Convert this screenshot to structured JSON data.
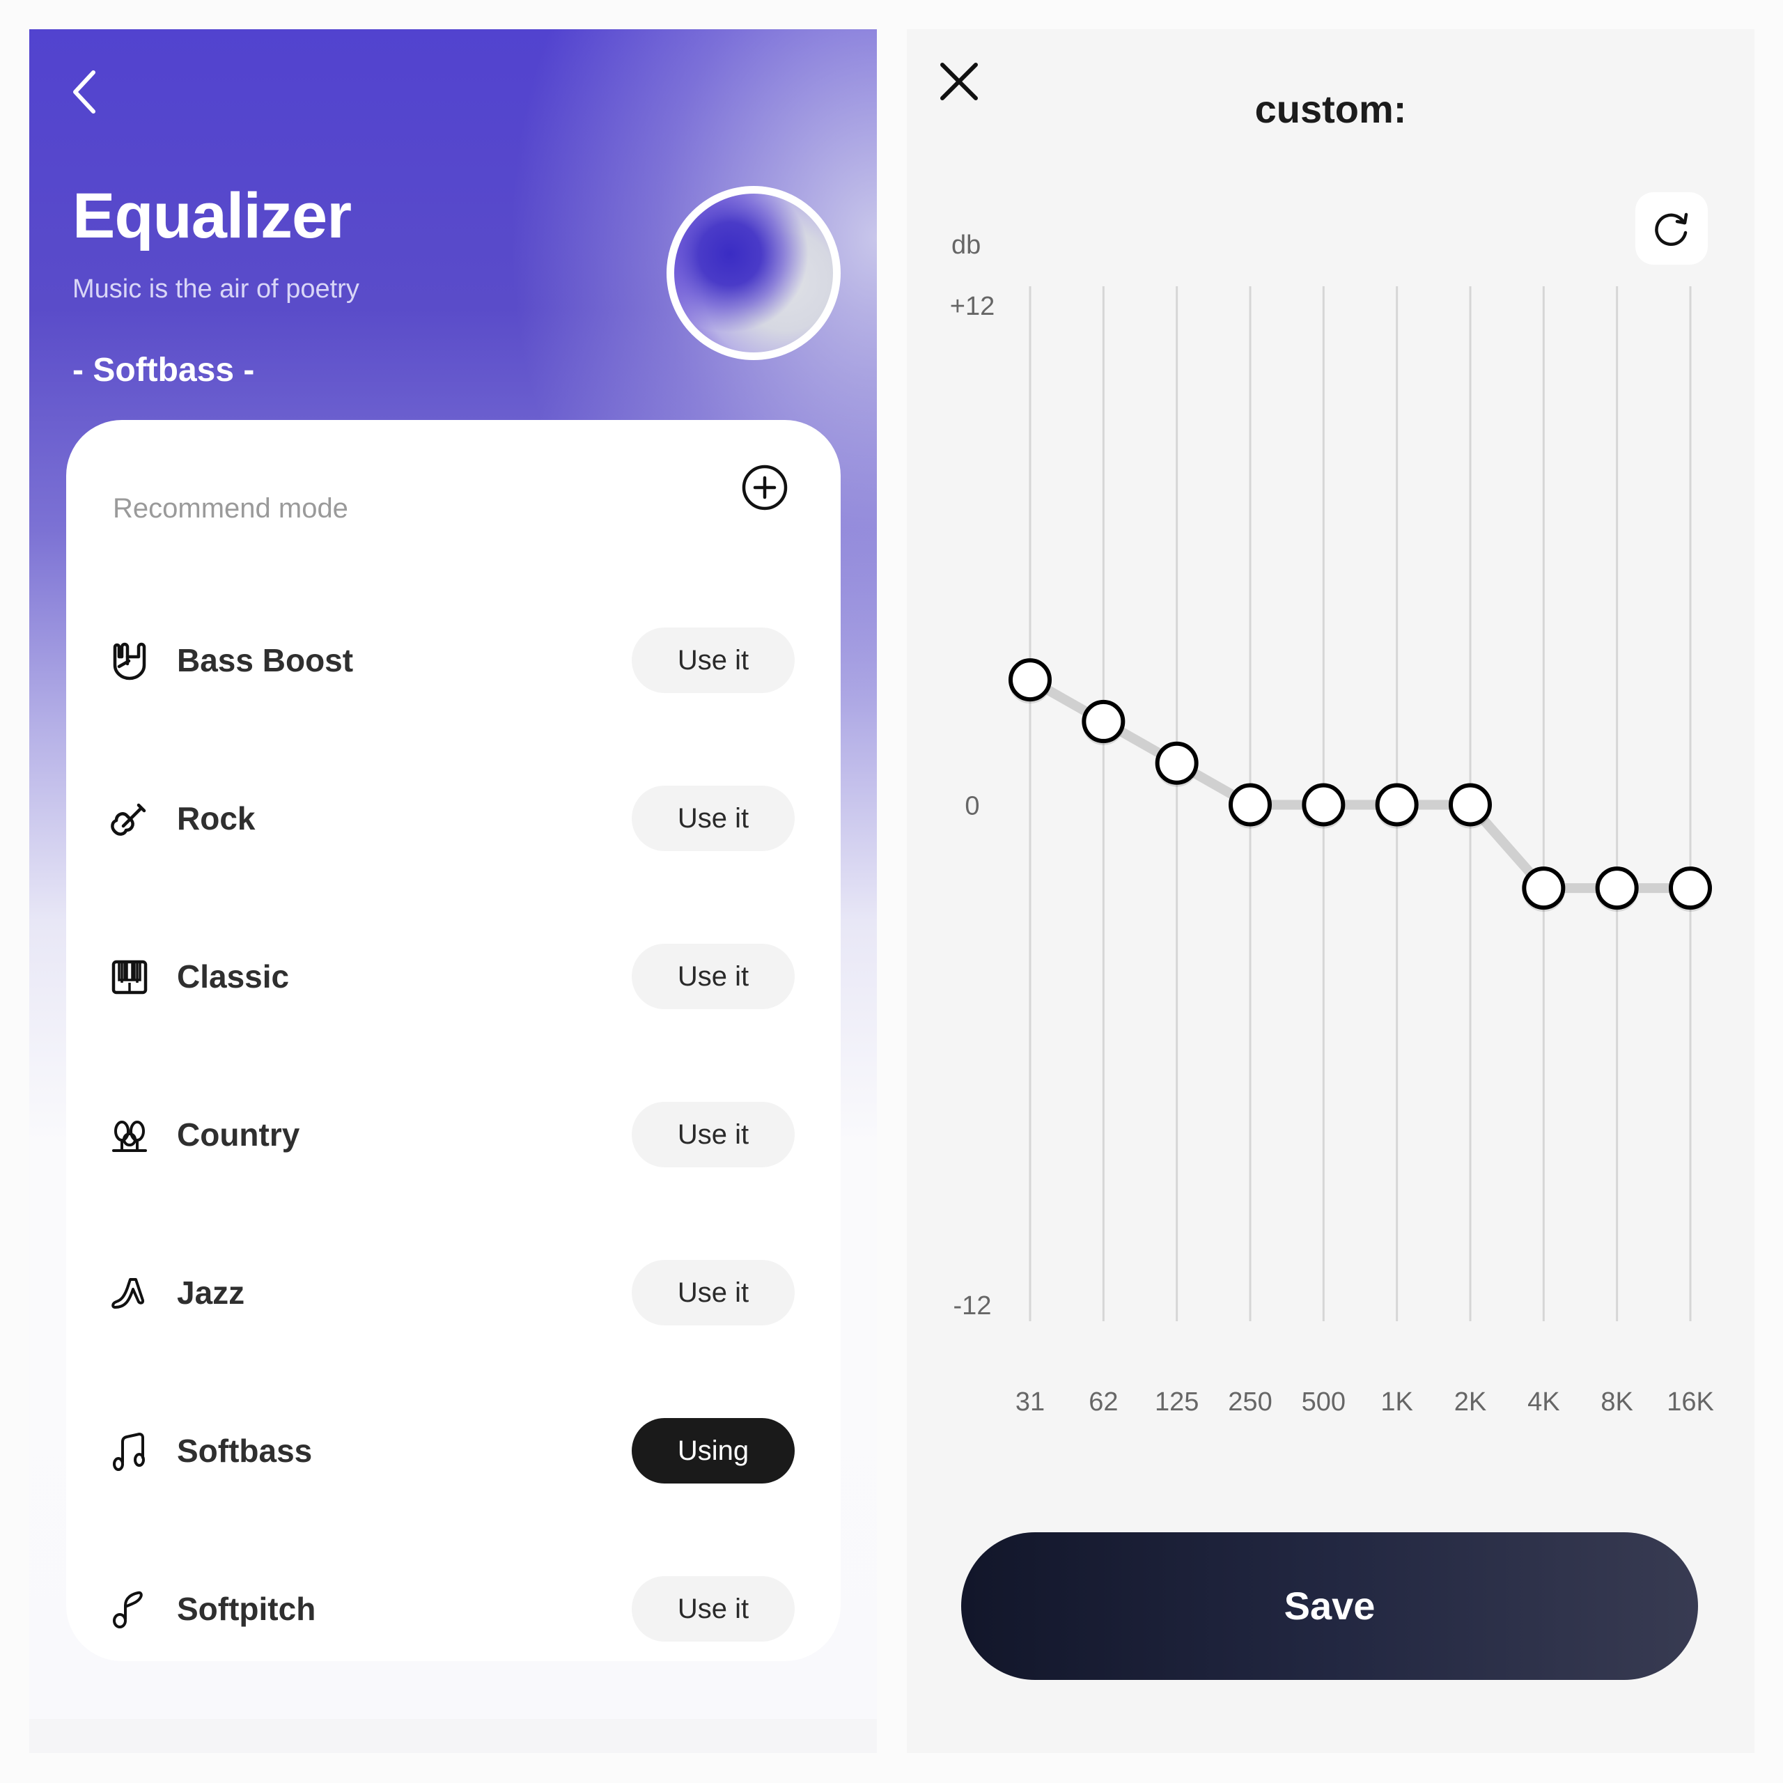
{
  "left": {
    "back_icon": "chevron-left-icon",
    "title": "Equalizer",
    "subtitle": "Music is the air of poetry",
    "current_mode": "- Softbass -",
    "card": {
      "header": "Recommend mode",
      "add_icon": "plus-circle-icon",
      "modes": [
        {
          "name": "Bass Boost",
          "icon": "rock-hand-icon",
          "button": "Use it",
          "active": false
        },
        {
          "name": "Rock",
          "icon": "guitar-icon",
          "button": "Use it",
          "active": false
        },
        {
          "name": "Classic",
          "icon": "piano-icon",
          "button": "Use it",
          "active": false
        },
        {
          "name": "Country",
          "icon": "trees-icon",
          "button": "Use it",
          "active": false
        },
        {
          "name": "Jazz",
          "icon": "saxophone-icon",
          "button": "Use it",
          "active": false
        },
        {
          "name": "Softbass",
          "icon": "music-notes-icon",
          "button": "Using",
          "active": true
        },
        {
          "name": "Softpitch",
          "icon": "music-note-icon",
          "button": "Use it",
          "active": false
        }
      ]
    },
    "colors": {
      "header_top": "#5243cf",
      "active_button": "#1a1a1a",
      "inactive_button": "#f3f3f3"
    }
  },
  "right": {
    "close_icon": "close-icon",
    "title": "custom:",
    "reset_icon": "refresh-icon",
    "save_label": "Save",
    "colors": {
      "save_button_start": "#12162a",
      "save_button_end": "#383b52",
      "line": "#cfcfcf",
      "point_stroke": "#000000"
    }
  },
  "chart_data": {
    "type": "line",
    "title": "custom:",
    "ylabel": "db",
    "xlabel": "",
    "categories": [
      "31",
      "62",
      "125",
      "250",
      "500",
      "1K",
      "2K",
      "4K",
      "8K",
      "16K"
    ],
    "values": [
      3,
      2,
      1,
      0,
      0,
      0,
      0,
      -2,
      -2,
      -2
    ],
    "ylim": [
      -12,
      12
    ],
    "yticks": [
      "+12",
      "0",
      "-12"
    ],
    "ytick_values": [
      12,
      0,
      -12
    ],
    "grid": "vertical",
    "legend": "none"
  }
}
